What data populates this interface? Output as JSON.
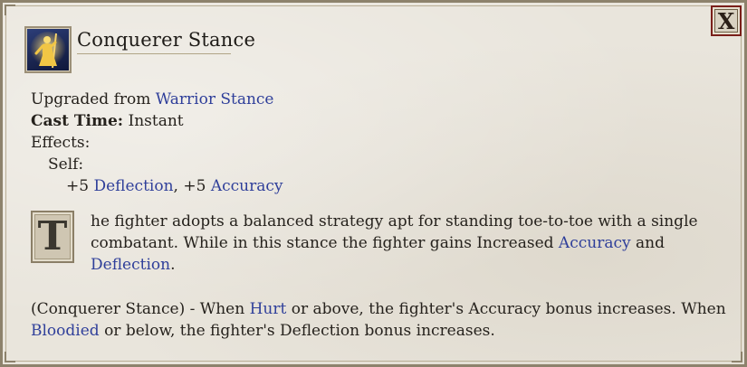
{
  "window": {
    "close_label": "X"
  },
  "header": {
    "title": "Conquerer Stance",
    "icon": "fighter-stance-icon"
  },
  "stats": {
    "upgraded_prefix": "Upgraded from",
    "upgraded_from": "Warrior Stance",
    "cast_time_label": "Cast Time:",
    "cast_time_value": "Instant",
    "effects_label": "Effects:",
    "self_label": "Self:",
    "deflection_bonus": "+5",
    "deflection_label": "Deflection",
    "comma": ",",
    "accuracy_bonus": "+5",
    "accuracy_label": "Accuracy"
  },
  "description": {
    "dropcap": "T",
    "part1": "he fighter adopts a balanced strategy apt for standing toe-to-toe with a single combatant. While in this stance the fighter gains Increased ",
    "link_accuracy": "Accuracy",
    "part2": " and ",
    "link_deflection": "Deflection",
    "part3": "."
  },
  "extra": {
    "part1": "(Conquerer Stance) - When ",
    "link_hurt": "Hurt",
    "part2": " or above, the fighter's Accuracy bonus increases. When ",
    "link_bloodied": "Bloodied",
    "part3": " or below, the fighter's Deflection bonus increases."
  },
  "colors": {
    "link": "#2f3f9a",
    "panel": "#e9e5dc",
    "close_border": "#7a1f1a"
  }
}
